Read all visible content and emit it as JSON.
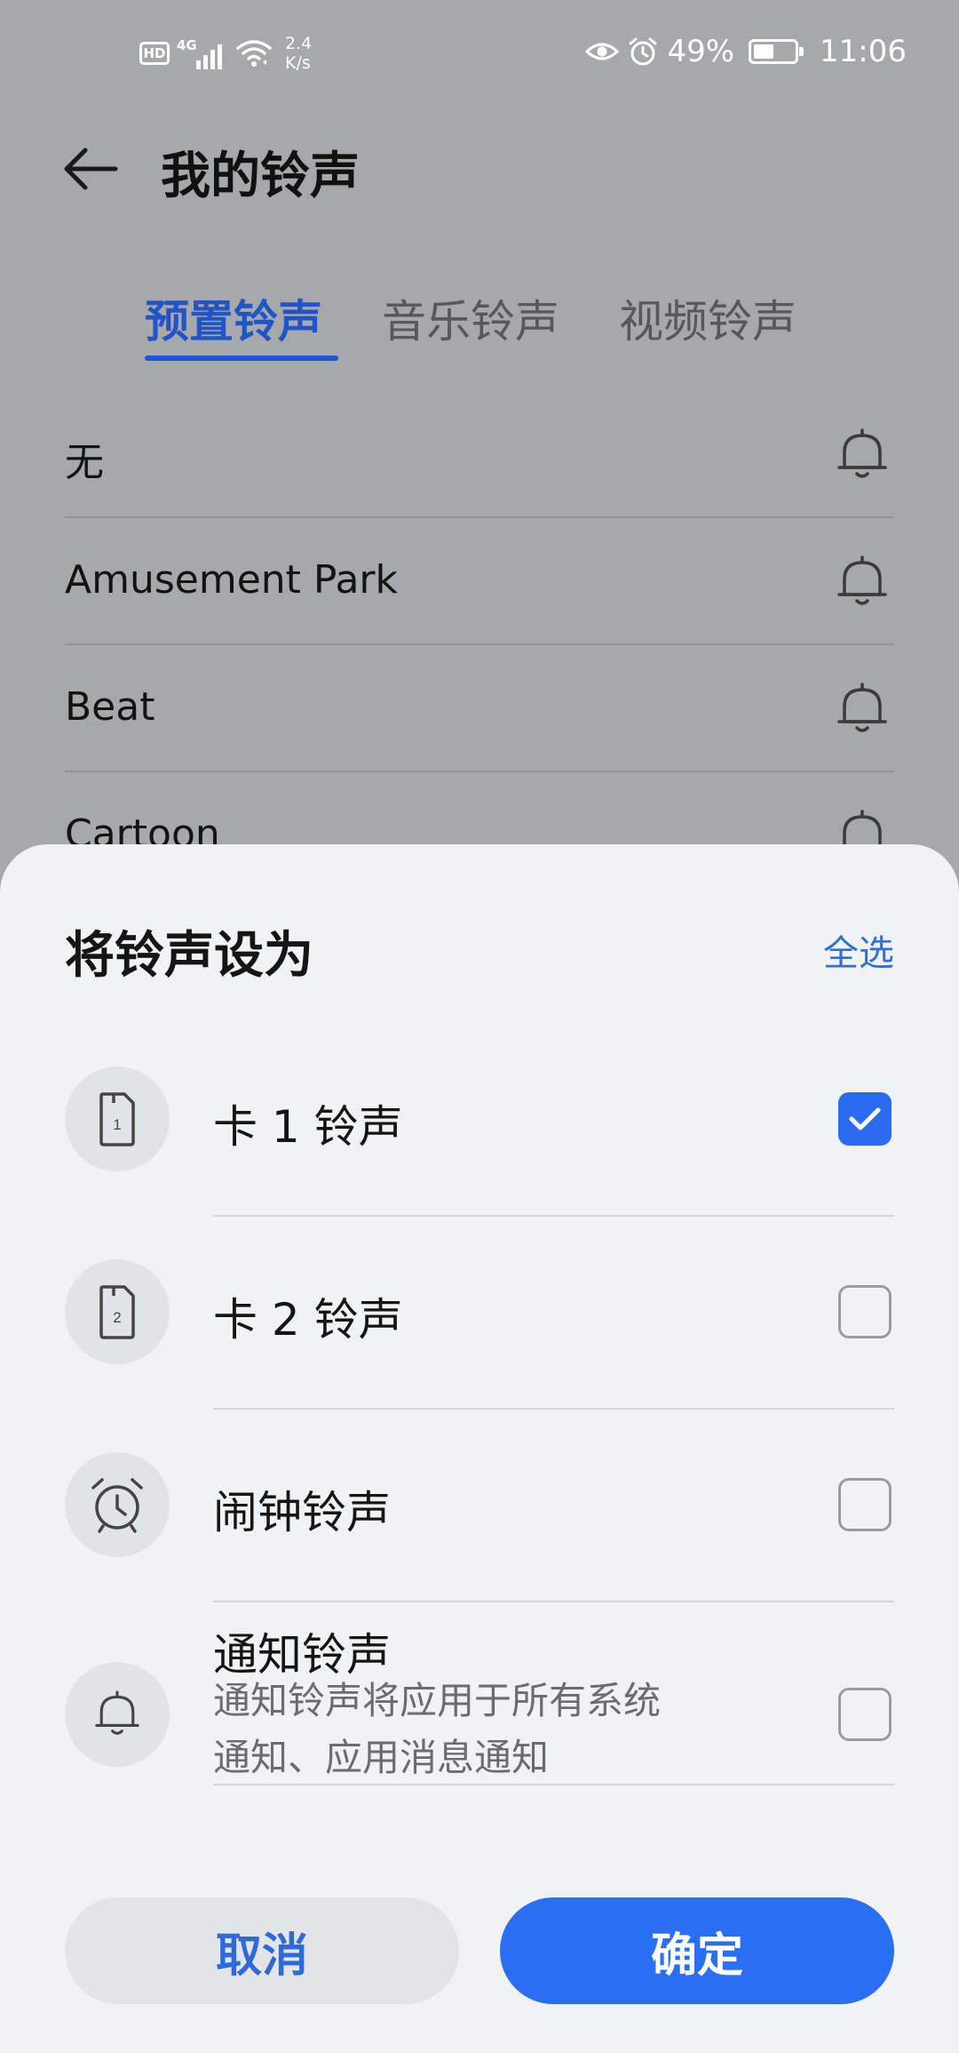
{
  "status_bar": {
    "hd": "HD",
    "network": "4G",
    "speed_value": "2.4",
    "speed_unit": "K/s",
    "battery_pct": "49%",
    "battery_level": 0.49,
    "time": "11:06"
  },
  "header": {
    "title": "我的铃声"
  },
  "tabs": [
    {
      "label": "预置铃声",
      "active": true
    },
    {
      "label": "音乐铃声",
      "active": false
    },
    {
      "label": "视频铃声",
      "active": false
    }
  ],
  "ringtones": [
    {
      "name": "无"
    },
    {
      "name": "Amusement Park"
    },
    {
      "name": "Beat"
    },
    {
      "name": "Cartoon"
    }
  ],
  "sheet": {
    "title": "将铃声设为",
    "select_all": "全选",
    "options": [
      {
        "label": "卡 1 铃声",
        "checked": true,
        "icon": "sim-card-1-icon",
        "sim_number": "1"
      },
      {
        "label": "卡 2 铃声",
        "checked": false,
        "icon": "sim-card-2-icon",
        "sim_number": "2"
      },
      {
        "label": "闹钟铃声",
        "checked": false,
        "icon": "alarm-clock-icon"
      },
      {
        "label": "通知铃声",
        "checked": false,
        "icon": "bell-icon",
        "description_line1": "通知铃声将应用于所有系统",
        "description_line2": "通知、应用消息通知"
      }
    ],
    "cancel_label": "取消",
    "confirm_label": "确定"
  },
  "colors": {
    "accent": "#2a6ef4",
    "tab_active": "#1f55c6",
    "scrim_background": "#a7a8aa",
    "sheet_background": "#f1f2f4"
  }
}
